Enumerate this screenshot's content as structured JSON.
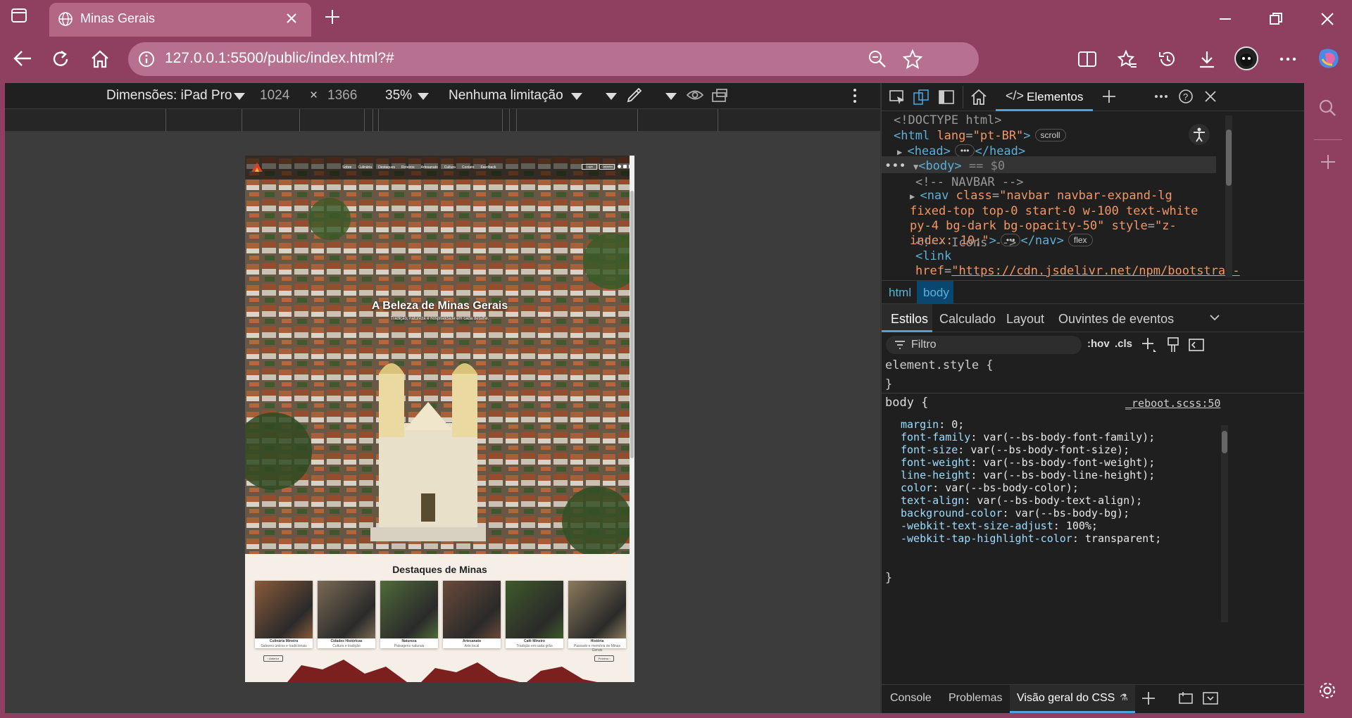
{
  "browser": {
    "tab_title": "Minas Gerais",
    "url": "127.0.0.1:5500/public/index.html?#"
  },
  "device_toolbar": {
    "dimensions_label": "Dimensões: iPad Pro",
    "width": "1024",
    "height": "1366",
    "zoom": "35%",
    "throttle": "Nenhuma limitação"
  },
  "site": {
    "nav_links": [
      "Sobre",
      "Culinária",
      "Destaques",
      "Roteiros",
      "Artesanato",
      "Cultura",
      "Contato",
      "Feedback"
    ],
    "hero_title": "A Beleza de Minas Gerais",
    "hero_subtitle": "Tradição, natureza e hospitalidade em cada detalhe.",
    "section_title": "Destaques de Minas",
    "cards": [
      {
        "title": "Culinária Mineira",
        "desc": "Sabores únicos e tradicionais",
        "color": "#8a5a3a"
      },
      {
        "title": "Cidades Históricas",
        "desc": "Cultura e tradição",
        "color": "#7a6a55"
      },
      {
        "title": "Natureza",
        "desc": "Paisagens naturais",
        "color": "#4f6b3a"
      },
      {
        "title": "Artesanato",
        "desc": "Arte local",
        "color": "#6a4a3a"
      },
      {
        "title": "Café Mineiro",
        "desc": "Tradição em cada grão",
        "color": "#3f5a2a"
      },
      {
        "title": "História",
        "desc": "Passado e memória de Minas Gerais",
        "color": "#8c7a5c"
      }
    ],
    "prev_label": "‹ Anterior",
    "next_label": "Próximo ›"
  },
  "devtools": {
    "tab_elements": "Elementos",
    "html_lines": [
      {
        "indent": 0,
        "text": "<!DOCTYPE html>",
        "kind": "com"
      },
      {
        "indent": 0,
        "html": true
      }
    ],
    "breadcrumb": [
      "html",
      "body"
    ],
    "style_tabs": [
      "Estilos",
      "Calculado",
      "Layout",
      "Ouvintes de eventos"
    ],
    "filter_placeholder": "Filtro",
    "hov": ":hov",
    "cls": ".cls",
    "element_style": "element.style {",
    "close_brace": "}",
    "body_selector": "body {",
    "source": "_reboot.scss:50",
    "css_rules": [
      {
        "prop": "margin",
        "val": "0;"
      },
      {
        "prop": "font-family",
        "val": "var(--bs-body-font-family);"
      },
      {
        "prop": "font-size",
        "val": "var(--bs-body-font-size);"
      },
      {
        "prop": "font-weight",
        "val": "var(--bs-body-font-weight);"
      },
      {
        "prop": "line-height",
        "val": "var(--bs-body-line-height);"
      },
      {
        "prop": "color",
        "val": "var(--bs-body-color);"
      },
      {
        "prop": "text-align",
        "val": "var(--bs-body-text-align);"
      },
      {
        "prop": "background-color",
        "val": "var(--bs-body-bg);"
      },
      {
        "prop": "-webkit-text-size-adjust",
        "val": "100%;"
      },
      {
        "prop": "-webkit-tap-highlight-color",
        "val": "transparent;"
      }
    ],
    "bottom_tabs": [
      "Console",
      "Problemas",
      "Visão geral do CSS"
    ]
  },
  "colors": {
    "accent": "#8f3f5f",
    "devtools_bg": "#1f1f1f",
    "selected_tab": "#4aa3df"
  }
}
